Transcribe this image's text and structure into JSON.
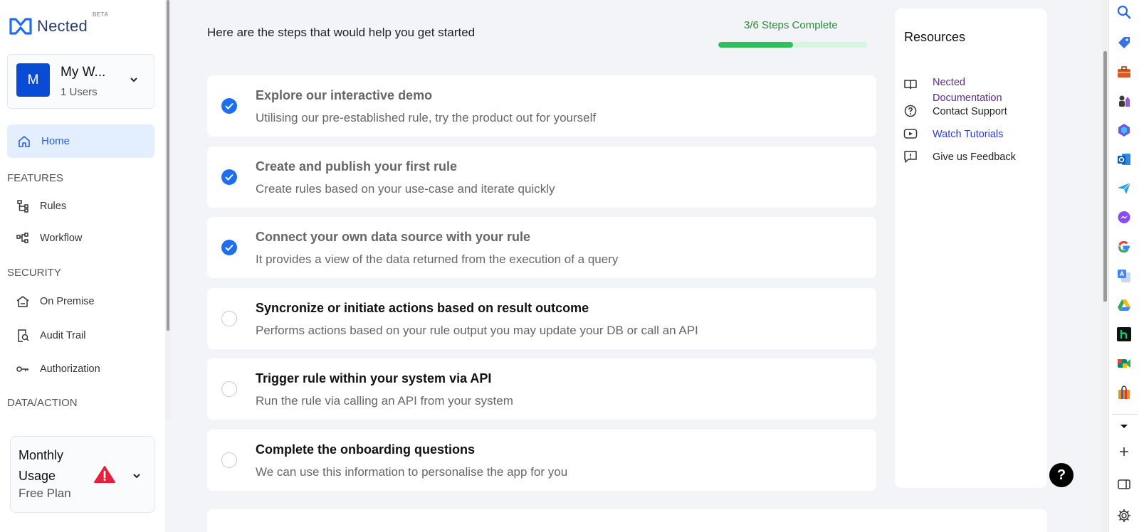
{
  "brand": {
    "name": "Nected",
    "badge": "BETA"
  },
  "workspace": {
    "avatar": "M",
    "name": "My W...",
    "users": "1 Users"
  },
  "nav": {
    "home": "Home",
    "features_heading": "FEATURES",
    "rules": "Rules",
    "workflow": "Workflow",
    "security_heading": "SECURITY",
    "on_premise": "On Premise",
    "audit_trail": "Audit Trail",
    "authorization": "Authorization",
    "data_action_heading": "DATA/ACTION"
  },
  "usage": {
    "title": "Monthly Usage",
    "plan": "Free Plan"
  },
  "main": {
    "title": "Here are the steps that would help you get started",
    "progress_label": "3/6 Steps Complete",
    "progress_fraction": 0.5
  },
  "steps": [
    {
      "title": "Explore our interactive demo",
      "desc": "Utilising our pre-established rule, try the product out for yourself",
      "done": true
    },
    {
      "title": "Create and publish your first rule",
      "desc": "Create rules based on your use-case and iterate quickly",
      "done": true
    },
    {
      "title": "Connect your own data source with your rule",
      "desc": "It provides a view of the data returned from the execution of a query",
      "done": true
    },
    {
      "title": "Syncronize or initiate actions based on result outcome",
      "desc": "Performs actions based on your rule output you may update your DB or call an API",
      "done": false
    },
    {
      "title": "Trigger rule within your system via API",
      "desc": "Run the rule via calling an API from your system",
      "done": false
    },
    {
      "title": "Complete the onboarding questions",
      "desc": "We can use this information to personalise the app for you",
      "done": false
    }
  ],
  "resources": {
    "title": "Resources",
    "items": [
      {
        "label": "Nected Documentation",
        "color": "#5a2d8a"
      },
      {
        "label": "Contact Support",
        "color": "#222222"
      },
      {
        "label": "Watch Tutorials",
        "color": "#2a3ad6"
      },
      {
        "label": "Give us Feedback",
        "color": "#222222"
      }
    ]
  },
  "help": {
    "label": "?"
  },
  "colors": {
    "accent": "#1e6ef0",
    "progress": "#2fbf5b",
    "warning": "#e8213a"
  }
}
